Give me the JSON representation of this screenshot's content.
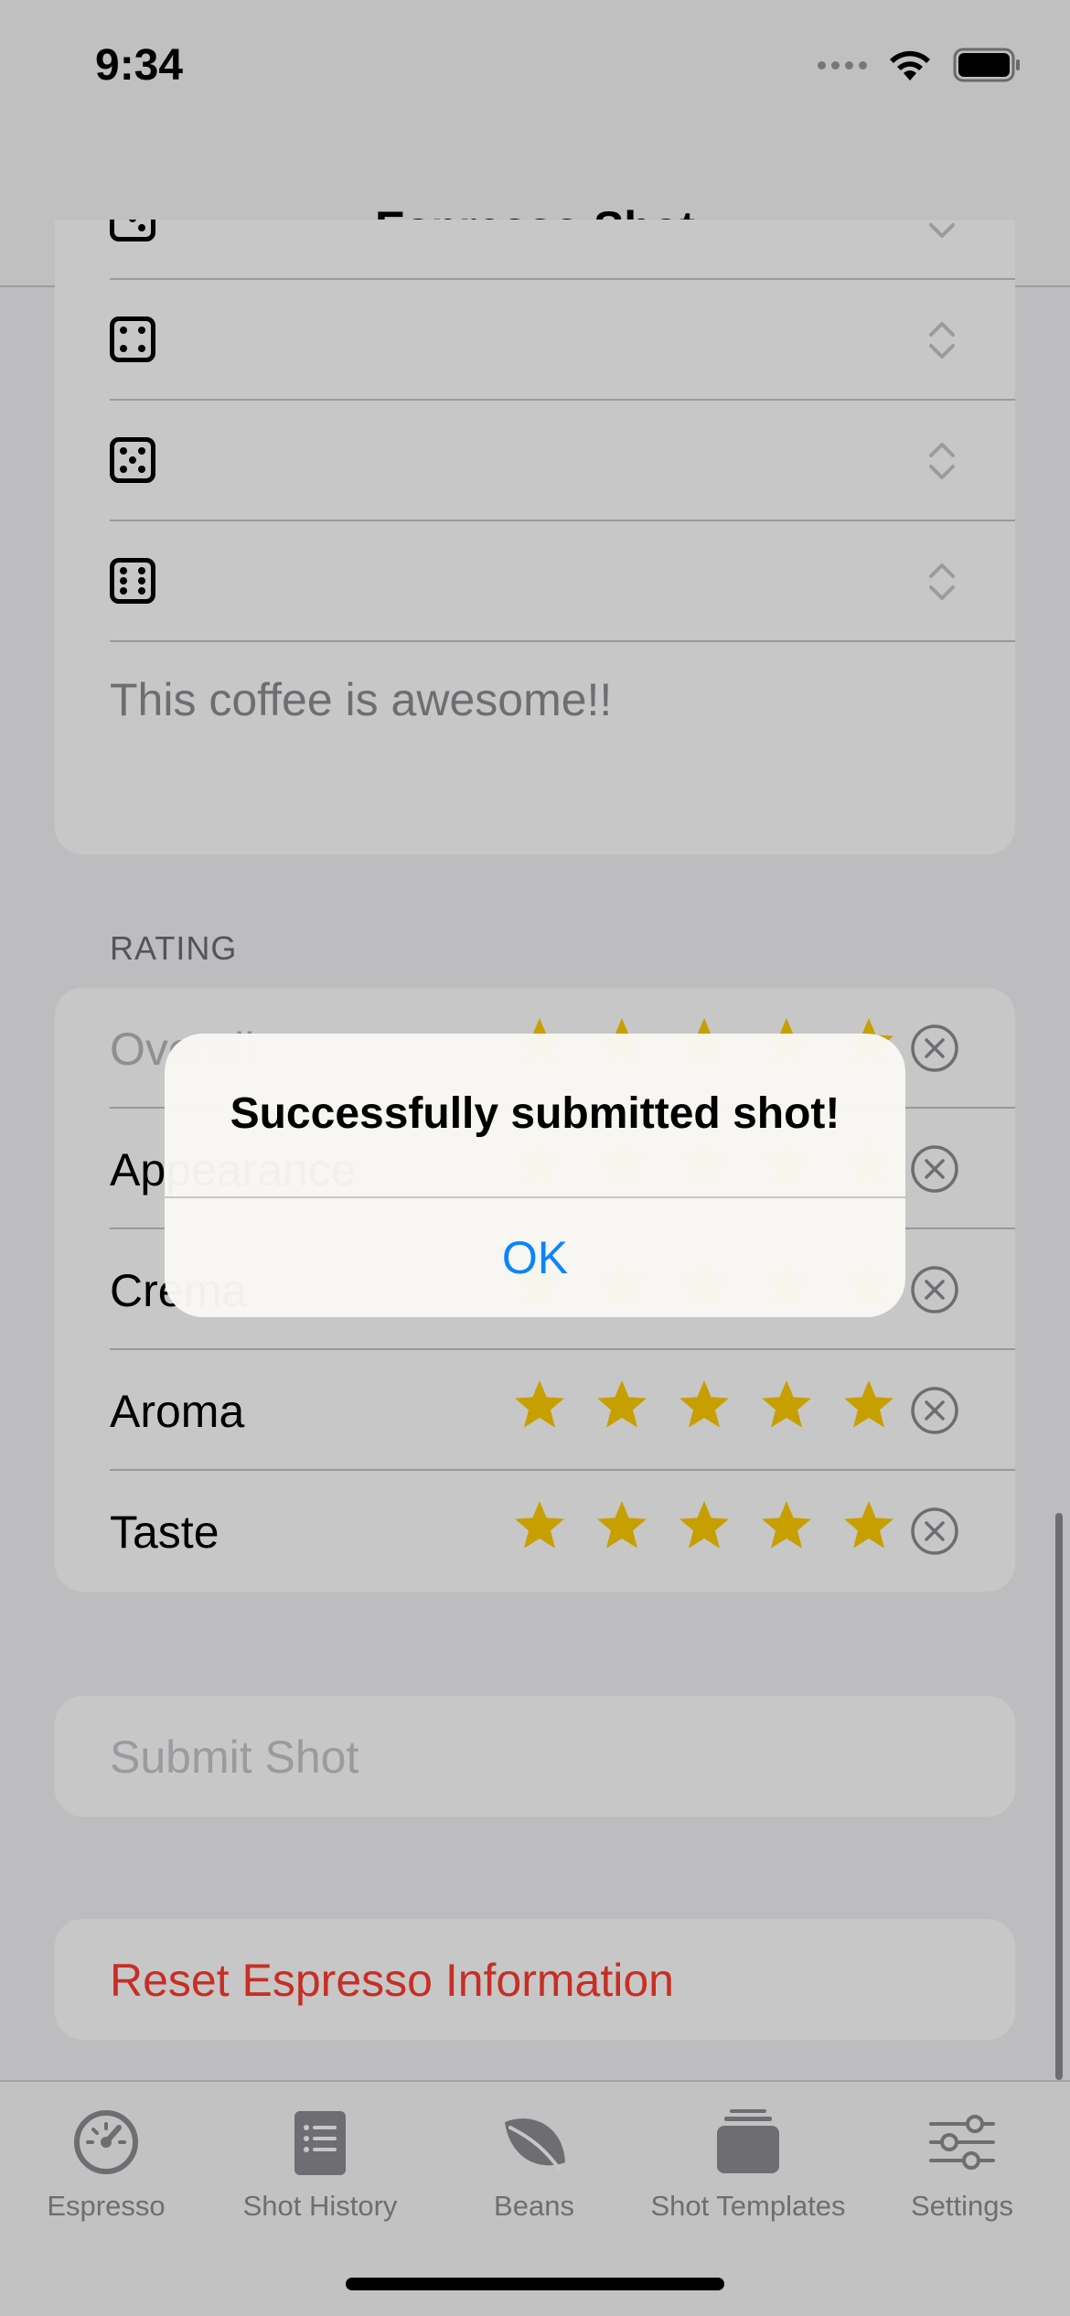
{
  "status_bar": {
    "time": "9:34"
  },
  "nav": {
    "title": "Espresso Shot"
  },
  "tasting_notes": {
    "text": "This coffee is awesome!!"
  },
  "rating": {
    "header": "RATING",
    "rows": [
      {
        "label": "Overall",
        "stars": 5
      },
      {
        "label": "Appearance",
        "stars": 5
      },
      {
        "label": "Crema",
        "stars": 5
      },
      {
        "label": "Aroma",
        "stars": 5
      },
      {
        "label": "Taste",
        "stars": 5
      }
    ]
  },
  "buttons": {
    "submit": "Submit Shot",
    "reset": "Reset Espresso Information"
  },
  "tabs": [
    {
      "label": "Espresso",
      "icon": "gauge-icon"
    },
    {
      "label": "Shot History",
      "icon": "book-icon"
    },
    {
      "label": "Beans",
      "icon": "leaf-icon"
    },
    {
      "label": "Shot Templates",
      "icon": "stack-icon"
    },
    {
      "label": "Settings",
      "icon": "sliders-icon"
    }
  ],
  "alert": {
    "title": "Successfully submitted shot!",
    "ok_label": "OK"
  },
  "colors": {
    "accent": "#0a84ff",
    "destructive": "#ff3b30",
    "star": "#ffcc00"
  }
}
